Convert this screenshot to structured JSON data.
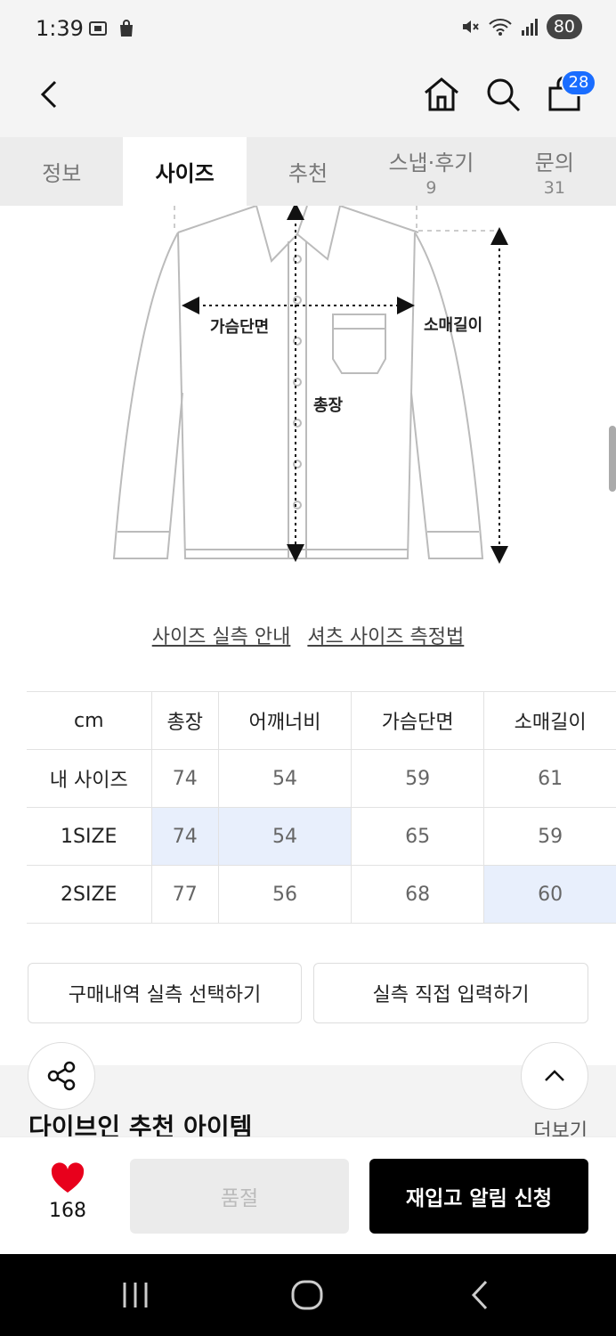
{
  "status": {
    "time": "1:39",
    "battery": "80",
    "left_icons": [
      "screenshot-icon",
      "shopping-bag-icon"
    ],
    "right_icons": [
      "mute-icon",
      "wifi-icon",
      "signal-icon"
    ]
  },
  "nav": {
    "icons": [
      "back-icon",
      "home-icon",
      "search-icon",
      "cart-icon"
    ],
    "cart_count": "28"
  },
  "tabs": [
    {
      "label": "정보",
      "count": ""
    },
    {
      "label": "사이즈",
      "count": ""
    },
    {
      "label": "추천",
      "count": ""
    },
    {
      "label": "스냅·후기",
      "count": "9"
    },
    {
      "label": "문의",
      "count": "31"
    }
  ],
  "active_tab": "사이즈",
  "diagram": {
    "labels": {
      "chest": "가슴단면",
      "length": "총장",
      "sleeve": "소매길이"
    }
  },
  "links": {
    "size_guide": "사이즈 실측 안내",
    "shirt_measure": "셔츠 사이즈 측정법"
  },
  "size_table": {
    "headers": [
      "cm",
      "총장",
      "어깨너비",
      "가슴단면",
      "소매길이"
    ],
    "rows": [
      [
        "내 사이즈",
        "74",
        "54",
        "59",
        "61"
      ],
      [
        "1SIZE",
        "74",
        "54",
        "65",
        "59"
      ],
      [
        "2SIZE",
        "77",
        "56",
        "68",
        "60"
      ]
    ],
    "highlight_color": "#e8effc"
  },
  "buttons": {
    "purchase_history": "구매내역 실측 선택하기",
    "direct_input": "실측 직접 입력하기"
  },
  "recommend": {
    "title": "다이브인 추천 아이템",
    "more": "더보기"
  },
  "bottom": {
    "like_count": "168",
    "soldout": "품절",
    "restock": "재입고 알림 신청"
  },
  "colors": {
    "accent_blue": "#1a6dff",
    "heart_red": "#e8001c",
    "cta_black": "#000000"
  }
}
